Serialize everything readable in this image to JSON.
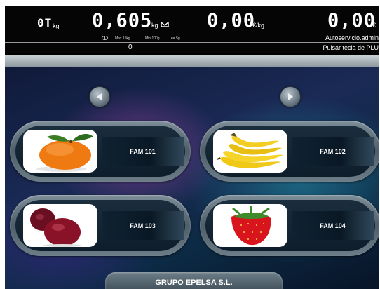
{
  "display": {
    "count_label": "0T",
    "count_unit": "kg",
    "weight_value": "0,605",
    "weight_unit": "kg",
    "price_per_kg_value": "0,00",
    "price_per_kg_unit": "€/kg",
    "total_value": "0,00",
    "total_unit": "€",
    "max_label": "Max 15kg",
    "min_label": "Min 100g",
    "division_label": "e= 5g",
    "user_label": "Autoservicio.admin",
    "plu_value": "0",
    "plu_prompt": "Pulsar tecla de PLU"
  },
  "navigation": {
    "prev_icon": "arrow-left-icon",
    "next_icon": "arrow-right-icon"
  },
  "families": [
    {
      "label": "FAM 101",
      "icon": "mandarin-image"
    },
    {
      "label": "FAM 102",
      "icon": "banana-image"
    },
    {
      "label": "FAM 103",
      "icon": "plum-image"
    },
    {
      "label": "FAM 104",
      "icon": "strawberry-image"
    }
  ],
  "footer": {
    "company": "GRUPO EPELSA S.L."
  },
  "colors": {
    "display_bg": "#050505",
    "label_bg": "#0f2232",
    "tile_frame": "#5f707b"
  }
}
